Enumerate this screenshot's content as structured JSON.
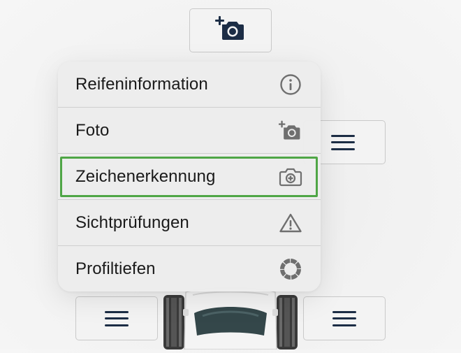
{
  "menu": {
    "items": [
      {
        "label": "Reifeninformation",
        "icon": "info-circle-icon"
      },
      {
        "label": "Foto",
        "icon": "add-photo-icon"
      },
      {
        "label": "Zeichenerkennung",
        "icon": "camera-scan-icon",
        "highlighted": true
      },
      {
        "label": "Sichtprüfungen",
        "icon": "warning-triangle-icon"
      },
      {
        "label": "Profiltiefen",
        "icon": "tire-ring-icon"
      }
    ],
    "highlight_color": "#4fa646"
  },
  "background_buttons": {
    "top": {
      "icon": "add-photo-icon"
    },
    "right": {
      "icon": "hamburger-menu-icon"
    },
    "bottom_left": {
      "icon": "hamburger-menu-icon"
    },
    "bottom_right": {
      "icon": "hamburger-menu-icon"
    }
  },
  "colors": {
    "icon_dark": "#1c2d45",
    "icon_gray": "#6f6f6f",
    "menu_text": "#1a1a1a"
  }
}
